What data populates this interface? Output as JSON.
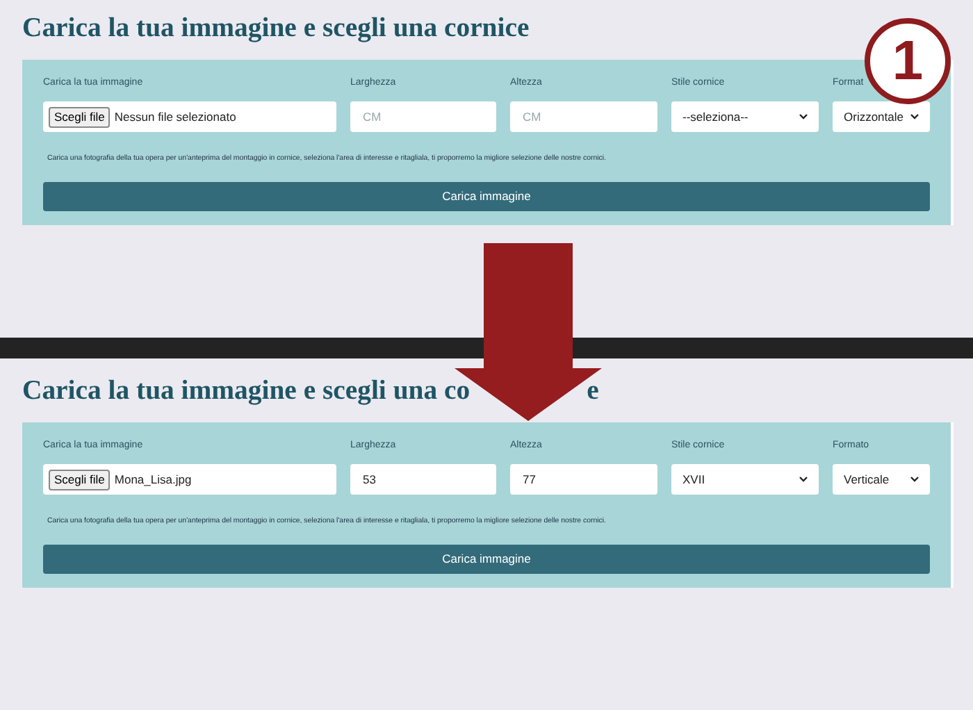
{
  "panels": [
    {
      "title": "Carica la tua immagine e scegli una cornice",
      "fields": [
        {
          "kind": "file",
          "label": "Carica la tua immagine",
          "button": "Scegli file",
          "value": "Nessun file selezionato"
        },
        {
          "kind": "text",
          "label": "Larghezza",
          "placeholder": "CM"
        },
        {
          "kind": "text",
          "label": "Altezza",
          "placeholder": "CM"
        },
        {
          "kind": "select",
          "label": "Stile cornice",
          "value": "--seleziona--"
        },
        {
          "kind": "select",
          "label": "Format",
          "value": "Orizzontale"
        }
      ],
      "help": "Carica una fotografia della tua opera per un'anteprima del montaggio in cornice, seleziona l'area di interesse e ritagliala, ti proporremo la migliore selezione delle nostre cornici.",
      "button": "Carica immagine"
    },
    {
      "title": "Carica la tua immagine e scegli una co",
      "title_tail": "e",
      "fields": [
        {
          "kind": "file",
          "label": "Carica la tua immagine",
          "button": "Scegli file",
          "value": "Mona_Lisa.jpg"
        },
        {
          "kind": "text",
          "label": "Larghezza",
          "value": "53"
        },
        {
          "kind": "text",
          "label": "Altezza",
          "value": "77"
        },
        {
          "kind": "select",
          "label": "Stile cornice",
          "value": "XVII"
        },
        {
          "kind": "select",
          "label": "Formato",
          "value": "Verticale"
        }
      ],
      "help": "Carica una fotografia della tua opera per un'anteprima del montaggio in cornice, seleziona l'area di interesse e ritagliala, ti proporremo la migliore selezione delle nostre cornici.",
      "button": "Carica immagine"
    }
  ],
  "step_badge": "1"
}
